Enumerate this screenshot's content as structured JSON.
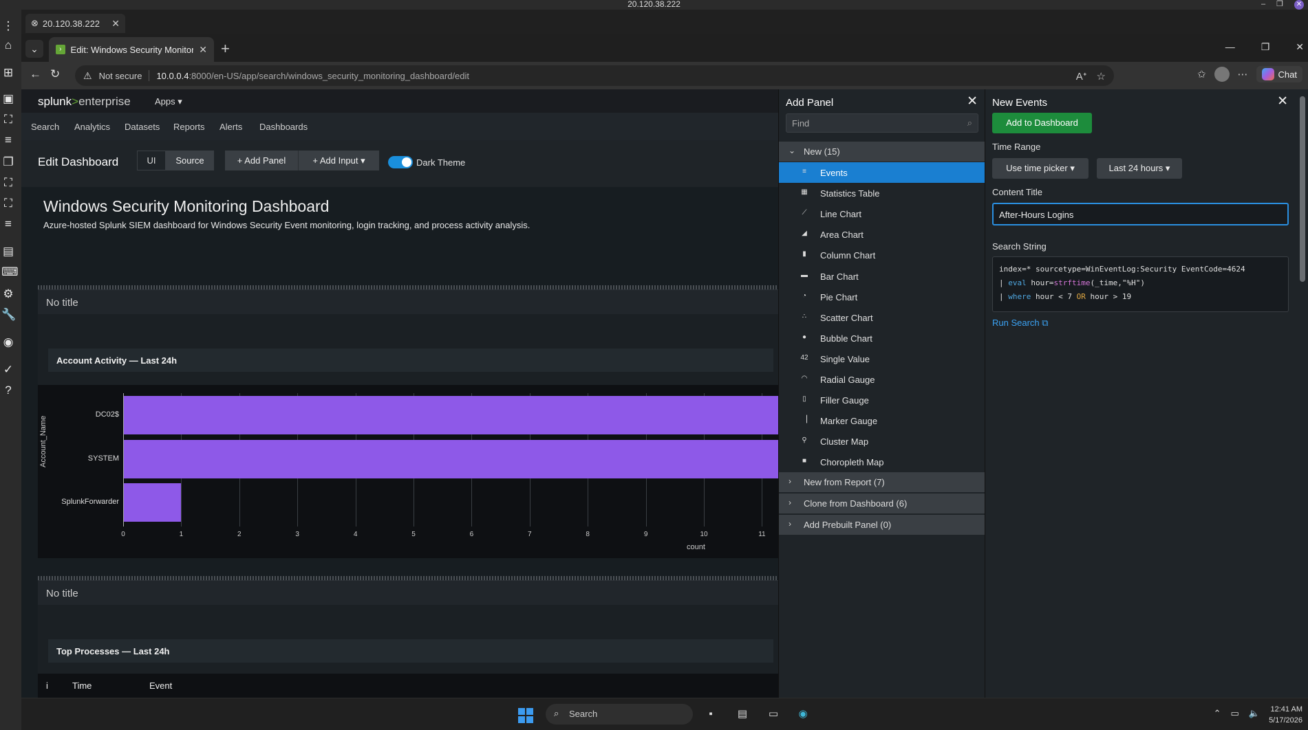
{
  "remote": {
    "title": "20.120.38.222",
    "tab_label": "20.120.38.222",
    "min": "–",
    "restore": "❐",
    "close": "✕"
  },
  "browser": {
    "tab_title": "Edit: Windows Security Monitoring",
    "tab_close": "✕",
    "new_tab": "+",
    "not_secure": "Not secure",
    "url_host": "10.0.0.4",
    "url_path": ":8000/en-US/app/search/windows_security_monitoring_dashboard/edit",
    "chat": "Chat"
  },
  "splunk": {
    "logo_main": "splunk",
    "logo_gt": ">",
    "logo_ent": "enterprise",
    "apps": "Apps ▾",
    "nav": [
      "Search",
      "Analytics",
      "Datasets",
      "Reports",
      "Alerts",
      "Dashboards"
    ],
    "edit_title": "Edit Dashboard",
    "ui_btn": "UI",
    "source_btn": "Source",
    "add_panel_btn": "+ Add Panel",
    "add_input_btn": "+ Add Input ▾",
    "dark_theme": "Dark Theme",
    "dash_title": "Windows Security Monitoring Dashboard",
    "dash_desc": "Azure-hosted Splunk SIEM dashboard for Windows Security Event monitoring, login tracking, and process activity analysis.",
    "panel1_title": "No title",
    "viz1_title": "Account Activity — Last 24h",
    "panel2_title": "No title",
    "viz2_title": "Top Processes — Last 24h",
    "events_cols": [
      "i",
      "Time",
      "Event"
    ]
  },
  "chart_data": {
    "type": "bar",
    "orientation": "horizontal",
    "categories": [
      "DC02$",
      "SYSTEM",
      "SplunkForwarder"
    ],
    "values": [
      12,
      12,
      1
    ],
    "xlabel": "count",
    "ylabel": "Account_Name",
    "xticks": [
      "0",
      "1",
      "2",
      "3",
      "4",
      "5",
      "6",
      "7",
      "8",
      "9",
      "10",
      "11"
    ],
    "bar_color": "#8e59e8"
  },
  "add_panel": {
    "title": "Add Panel",
    "find_placeholder": "Find",
    "group_new": "New (15)",
    "items": [
      {
        "label": "Events",
        "icon": "≡"
      },
      {
        "label": "Statistics Table",
        "icon": "▦"
      },
      {
        "label": "Line Chart",
        "icon": "⟋"
      },
      {
        "label": "Area Chart",
        "icon": "◢"
      },
      {
        "label": "Column Chart",
        "icon": "▮"
      },
      {
        "label": "Bar Chart",
        "icon": "▬"
      },
      {
        "label": "Pie Chart",
        "icon": "◔"
      },
      {
        "label": "Scatter Chart",
        "icon": "∴"
      },
      {
        "label": "Bubble Chart",
        "icon": "●"
      },
      {
        "label": "Single Value",
        "icon": "42"
      },
      {
        "label": "Radial Gauge",
        "icon": "◠"
      },
      {
        "label": "Filler Gauge",
        "icon": "▯"
      },
      {
        "label": "Marker Gauge",
        "icon": "▕"
      },
      {
        "label": "Cluster Map",
        "icon": "⚲"
      },
      {
        "label": "Choropleth Map",
        "icon": "■"
      }
    ],
    "group_report": "New from Report (7)",
    "group_clone": "Clone from Dashboard (6)",
    "group_prebuilt": "Add Prebuilt Panel (0)"
  },
  "new_events": {
    "title": "New Events",
    "add_btn": "Add to Dashboard",
    "time_range_label": "Time Range",
    "time_picker": "Use time picker ▾",
    "time_value": "Last 24 hours ▾",
    "content_title_label": "Content Title",
    "content_title_value": "After-Hours Logins",
    "search_string_label": "Search String",
    "search_line1": "index=* sourcetype=WinEventLog:Security EventCode=4624",
    "run_search": "Run Search ⧉"
  },
  "taskbar": {
    "search": "Search",
    "time": "12:41 AM",
    "date": "5/17/2026"
  }
}
